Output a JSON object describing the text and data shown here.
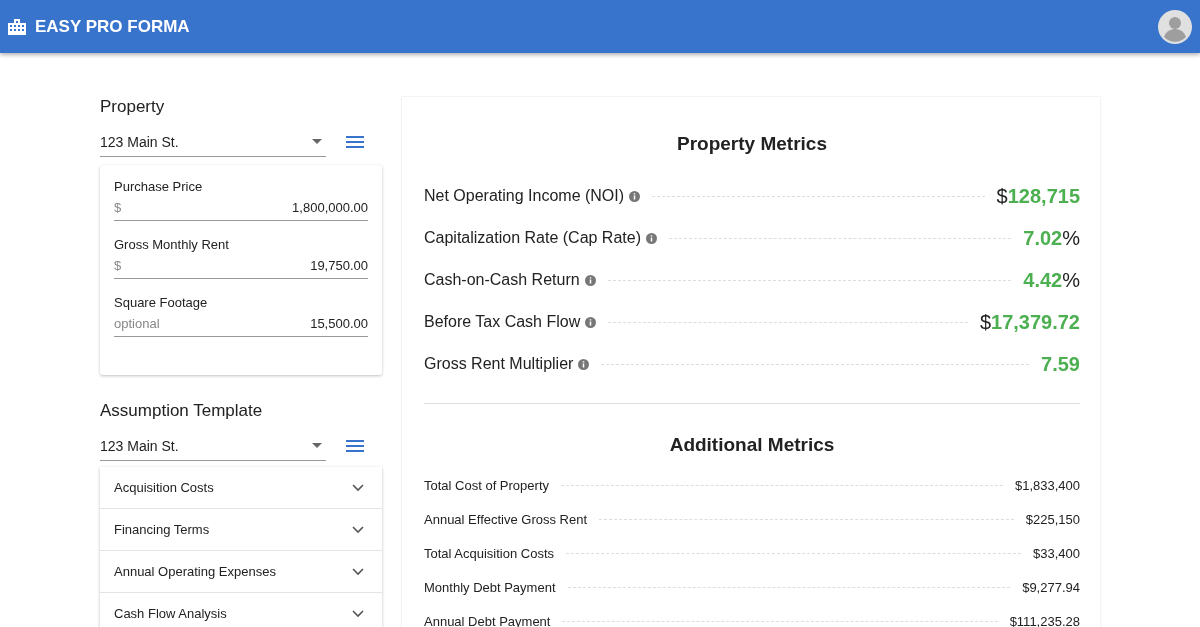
{
  "app_bar": {
    "title": "EASY PRO FORMA"
  },
  "property": {
    "heading": "Property",
    "select_value": "123 Main St.",
    "fields": [
      {
        "label": "Purchase Price",
        "prefix": "$",
        "value": "1,800,000.00"
      },
      {
        "label": "Gross Monthly Rent",
        "prefix": "$",
        "value": "19,750.00"
      },
      {
        "label": "Square Footage",
        "prefix": "optional",
        "value": "15,500.00"
      }
    ]
  },
  "assumption_template": {
    "heading": "Assumption Template",
    "select_value": "123 Main St.",
    "panels": [
      {
        "label": "Acquisition Costs",
        "expanded": false
      },
      {
        "label": "Financing Terms",
        "expanded": false
      },
      {
        "label": "Annual Operating Expenses",
        "expanded": false
      },
      {
        "label": "Cash Flow Analysis",
        "expanded": false
      }
    ]
  },
  "property_metrics": {
    "title": "Property Metrics",
    "items": [
      {
        "label": "Net Operating Income (NOI)",
        "prefix": "$",
        "value": "128,715"
      },
      {
        "label": "Capitalization Rate (Cap Rate)",
        "value": "7.02",
        "suffix": "%"
      },
      {
        "label": "Cash-on-Cash Return",
        "value": "4.42",
        "suffix": "%"
      },
      {
        "label": "Before Tax Cash Flow",
        "prefix": "$",
        "value": "17,379.72"
      },
      {
        "label": "Gross Rent Multiplier",
        "value": "7.59"
      }
    ]
  },
  "additional_metrics": {
    "title": "Additional Metrics",
    "items": [
      {
        "label": "Total Cost of Property",
        "value": "$1,833,400"
      },
      {
        "label": "Annual Effective Gross Rent",
        "value": "$225,150"
      },
      {
        "label": "Total Acquisition Costs",
        "value": "$33,400"
      },
      {
        "label": "Monthly Debt Payment",
        "value": "$9,277.94"
      },
      {
        "label": "Annual Debt Payment",
        "value": "$111,235.28"
      }
    ]
  }
}
